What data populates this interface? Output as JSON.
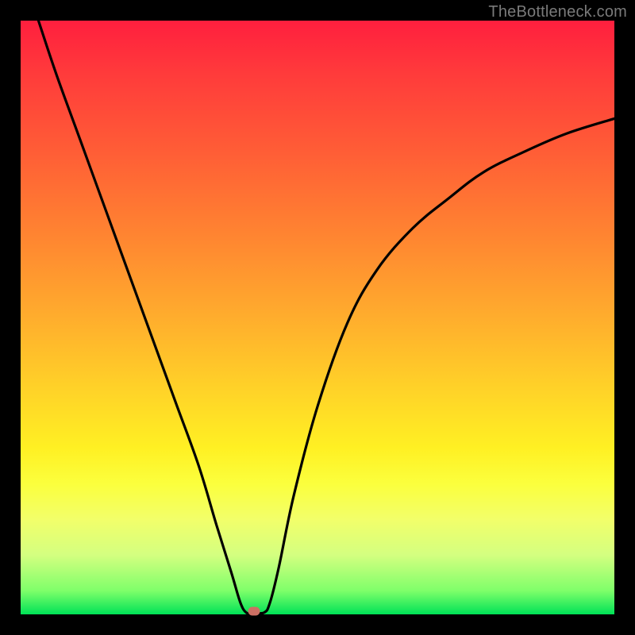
{
  "watermark": "TheBottleneck.com",
  "chart_data": {
    "type": "line",
    "title": "",
    "xlabel": "",
    "ylabel": "",
    "xlim": [
      0,
      100
    ],
    "ylim": [
      0,
      100
    ],
    "grid": false,
    "legend": false,
    "series": [
      {
        "name": "curve",
        "x": [
          3,
          6,
          10,
          14,
          18,
          22,
          26,
          30,
          33,
          35.5,
          37,
          38,
          39,
          41,
          42,
          43.5,
          46,
          50,
          55,
          60,
          66,
          72,
          78,
          85,
          92,
          100
        ],
        "y": [
          100,
          91,
          80,
          69,
          58,
          47,
          36,
          25,
          15,
          7,
          2,
          0.3,
          0.3,
          0.3,
          2,
          8,
          20,
          35,
          49,
          58,
          65,
          70,
          74.5,
          78,
          81,
          83.5
        ]
      }
    ],
    "marker": {
      "x": 39.3,
      "y": 0.5,
      "color": "#cc6f63"
    },
    "gradient_stops": [
      {
        "pos": 0,
        "color": "#ff1f3e"
      },
      {
        "pos": 9,
        "color": "#ff3b3b"
      },
      {
        "pos": 22,
        "color": "#ff5d36"
      },
      {
        "pos": 36,
        "color": "#ff8431"
      },
      {
        "pos": 50,
        "color": "#ffad2d"
      },
      {
        "pos": 62,
        "color": "#ffd228"
      },
      {
        "pos": 72,
        "color": "#fff023"
      },
      {
        "pos": 78,
        "color": "#fbff3d"
      },
      {
        "pos": 84,
        "color": "#f2ff6a"
      },
      {
        "pos": 90,
        "color": "#d4ff80"
      },
      {
        "pos": 96,
        "color": "#7fff6a"
      },
      {
        "pos": 100,
        "color": "#00e257"
      }
    ]
  }
}
